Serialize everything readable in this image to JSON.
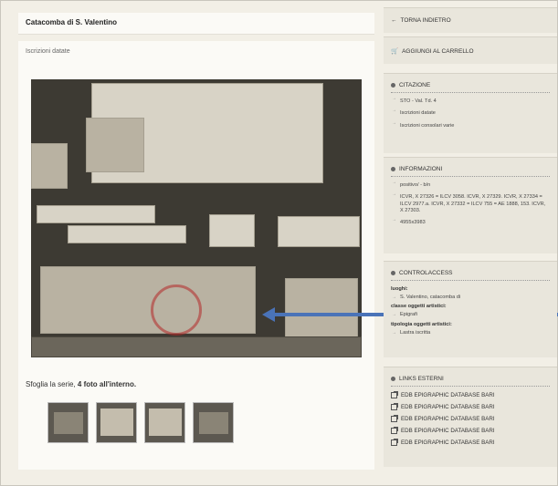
{
  "header": {
    "title": "Catacomba di S. Valentino"
  },
  "main": {
    "subtitle": "Iscrizioni datate",
    "series_prefix": "Sfoglia la serie, ",
    "series_bold": "4 foto all'interno."
  },
  "sidebar": {
    "back_label": "TORNA INDIETRO",
    "cart_label": "AGGIUNGI AL CARRELLO",
    "citazione": {
      "title": "CITAZIONE",
      "items": [
        "STO - Val. Td. 4",
        "Iscrizioni datate",
        "Iscrizioni consolari varie"
      ]
    },
    "informazioni": {
      "title": "INFORMAZIONI",
      "items": [
        "positivo/ - b/n",
        "ICVR, X 27326 = ILCV 3058. ICVR, X 27329. ICVR, X 27334 = ILCV 2977.a. ICVR, X 27332 = ILCV 755 = AE 1888, 153. ICVR, X 27303.",
        "4955x3983"
      ]
    },
    "controlaccess": {
      "title": "CONTROLACCESS",
      "luoghi_label": "luoghi:",
      "luoghi_item": "S. Valentino, catacomba di",
      "soggetti_label": "classe oggetti artistici:",
      "soggetti_item": "Epigrafi",
      "tipologia_label": "tipologia oggetti artistici:",
      "tipologia_item": "Lastra iscritta"
    },
    "links": {
      "title": "LINKS ESTERNI",
      "items": [
        "EDB EPIGRAPHIC DATABASE BARI",
        "EDB EPIGRAPHIC DATABASE BARI",
        "EDB EPIGRAPHIC DATABASE BARI",
        "EDB EPIGRAPHIC DATABASE BARI",
        "EDB EPIGRAPHIC DATABASE BARI"
      ]
    }
  },
  "colors": {
    "arrow": "#4a73b8",
    "background": "#efece3"
  }
}
